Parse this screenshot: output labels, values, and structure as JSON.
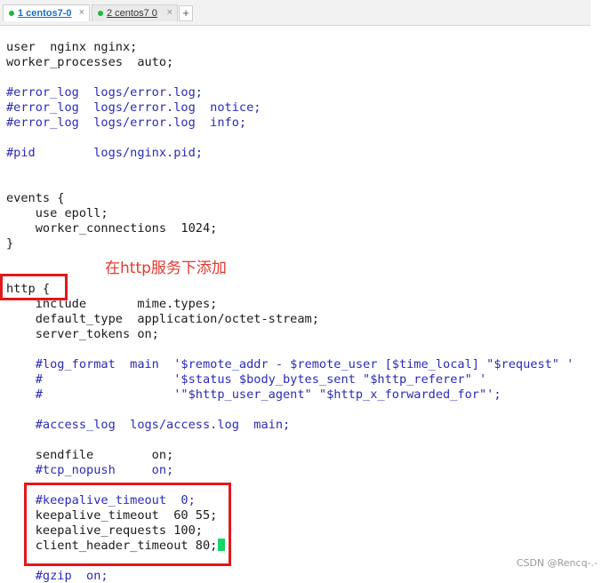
{
  "tabs": [
    {
      "label": "1 centos7-0",
      "close": "×",
      "active": true
    },
    {
      "label": "2 centos7 0",
      "close": "×",
      "active": false
    }
  ],
  "new_tab_label": "+",
  "status_dot_color": "#1fb83a",
  "terminal": {
    "lines": [
      "user  nginx nginx;",
      "worker_processes  auto;",
      "#error_log  logs/error.log;",
      "#error_log  logs/error.log  notice;",
      "#error_log  logs/error.log  info;",
      "#pid        logs/nginx.pid;",
      "events {",
      "    use epoll;",
      "    worker_connections  1024;",
      "}",
      "http {",
      "    include       mime.types;",
      "    default_type  application/octet-stream;",
      "    server_tokens on;",
      "    #log_format  main  '$remote_addr - $remote_user [$time_local] \"$request\" '",
      "    #                  '$status $body_bytes_sent \"$http_referer\" '",
      "    #                  '\"$http_user_agent\" \"$http_x_forwarded_for\"';",
      "    #access_log  logs/access.log  main;",
      "    sendfile        on;",
      "    #tcp_nopush     on;",
      "    #keepalive_timeout  0;",
      "    keepalive_timeout  60 55;",
      "    keepalive_requests 100;",
      "    client_header_timeout 80;",
      "    #gzip  on;"
    ],
    "cursor_color": "#19d36a"
  },
  "annotation": {
    "text": "在http服务下添加",
    "color": "#e23a2e"
  },
  "highlight_color": "#e0191c",
  "watermark": "CSDN @Rencq-.-"
}
